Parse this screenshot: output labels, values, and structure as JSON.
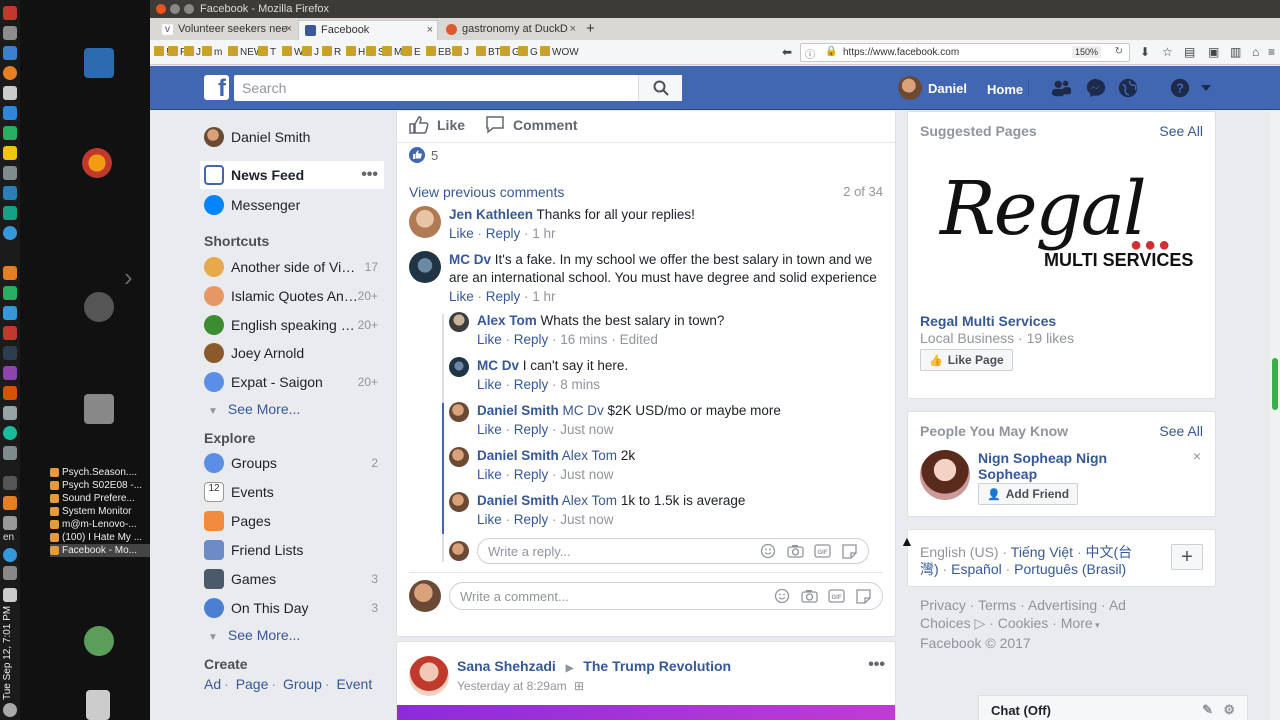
{
  "os": {
    "clock": "Tue Sep 12, 7:01 PM",
    "keyboard": "en",
    "taskbar": [
      {
        "label": "Psych.Season...."
      },
      {
        "label": "Psych S02E08 -..."
      },
      {
        "label": "Sound Prefere..."
      },
      {
        "label": "System Monitor"
      },
      {
        "label": "m@m-Lenovo-..."
      },
      {
        "label": "(100) I Hate My ..."
      },
      {
        "label": "Facebook - Mo..."
      }
    ]
  },
  "browser": {
    "window_title": "Facebook - Mozilla Firefox",
    "tabs": [
      {
        "label": "Volunteer seekers nee"
      },
      {
        "label": "Facebook"
      },
      {
        "label": "gastronomy at DuckD"
      }
    ],
    "bookmarks": [
      "!",
      "F",
      "J",
      "m",
      "NEW",
      "T",
      "W",
      "J",
      "R",
      "H",
      "SC",
      "M",
      "E",
      "EB",
      "J",
      "BTC",
      "G",
      "G",
      "WOW"
    ],
    "url": "https://www.facebook.com",
    "zoom": "150%"
  },
  "fb": {
    "search_placeholder": "Search",
    "user_name": "Daniel",
    "home": "Home"
  },
  "leftnav": {
    "profile": "Daniel Smith",
    "news_feed": "News Feed",
    "messenger": "Messenger",
    "shortcuts_title": "Shortcuts",
    "shortcuts": [
      {
        "label": "Another side of Viet...",
        "count": "17"
      },
      {
        "label": "Islamic Quotes And...",
        "count": "20+"
      },
      {
        "label": "English speaking g...",
        "count": "20+"
      },
      {
        "label": "Joey Arnold",
        "count": ""
      },
      {
        "label": "Expat - Saigon",
        "count": "20+"
      }
    ],
    "see_more": "See More...",
    "explore_title": "Explore",
    "explore": [
      {
        "label": "Groups",
        "count": "2"
      },
      {
        "label": "Events",
        "count": ""
      },
      {
        "label": "Pages",
        "count": ""
      },
      {
        "label": "Friend Lists",
        "count": ""
      },
      {
        "label": "Games",
        "count": "3"
      },
      {
        "label": "On This Day",
        "count": "3"
      }
    ],
    "create_title": "Create",
    "create": [
      "Ad",
      "Page",
      "Group",
      "Event"
    ]
  },
  "post": {
    "like": "Like",
    "comment": "Comment",
    "like_count": "5",
    "view_previous": "View previous comments",
    "comment_pager": "2 of 34",
    "comments": [
      {
        "name": "Jen Kathleen",
        "mention": "",
        "text": "Thanks for all your replies!",
        "time": "1 hr",
        "extra": ""
      },
      {
        "name": "MC Dv",
        "mention": "",
        "text": "It's a fake. In my school we offer the best salary in town and we are an international school. You must have degree and solid experience",
        "time": "1 hr",
        "extra": ""
      }
    ],
    "replies": [
      {
        "name": "Alex Tom",
        "mention": "",
        "text": "Whats the best salary in town?",
        "time": "16 mins",
        "extra": "Edited"
      },
      {
        "name": "MC Dv",
        "mention": "",
        "text": "I can't say it here.",
        "time": "8 mins",
        "extra": ""
      },
      {
        "name": "Daniel Smith",
        "mention": "MC Dv",
        "text": "$2K USD/mo or maybe more",
        "time": "Just now",
        "extra": ""
      },
      {
        "name": "Daniel Smith",
        "mention": "Alex Tom",
        "text": "2k",
        "time": "Just now",
        "extra": ""
      },
      {
        "name": "Daniel Smith",
        "mention": "Alex Tom",
        "text": "1k to 1.5k is average",
        "time": "Just now",
        "extra": ""
      }
    ],
    "meta_like": "Like",
    "meta_reply": "Reply",
    "reply_placeholder": "Write a reply...",
    "comment_placeholder": "Write a comment..."
  },
  "post2": {
    "author": "Sana Shehzadi",
    "target": "The Trump Revolution",
    "time": "Yesterday at 8:29am"
  },
  "right": {
    "suggested_title": "Suggested Pages",
    "see_all": "See All",
    "logo_text": "Regal",
    "logo_sub": "MULTI SERVICES",
    "page_name": "Regal Multi Services",
    "page_meta": "Local Business · 19 likes",
    "like_page": "Like Page",
    "pymk_title": "People You May Know",
    "person_name": "Nign Sopheap Nign Sopheap",
    "add_friend": "Add Friend",
    "lang_current": "English (US)",
    "languages": [
      "Tiếng Việt",
      "中文(台灣)",
      "Español",
      "Português (Brasil)"
    ],
    "footer": [
      "Privacy",
      "Terms",
      "Advertising",
      "Ad Choices",
      "Cookies",
      "More"
    ],
    "copyright": "Facebook © 2017",
    "chat": "Chat (Off)"
  },
  "colors": {
    "fb_blue": "#4267b2",
    "link": "#365899",
    "meta": "#90949c"
  }
}
